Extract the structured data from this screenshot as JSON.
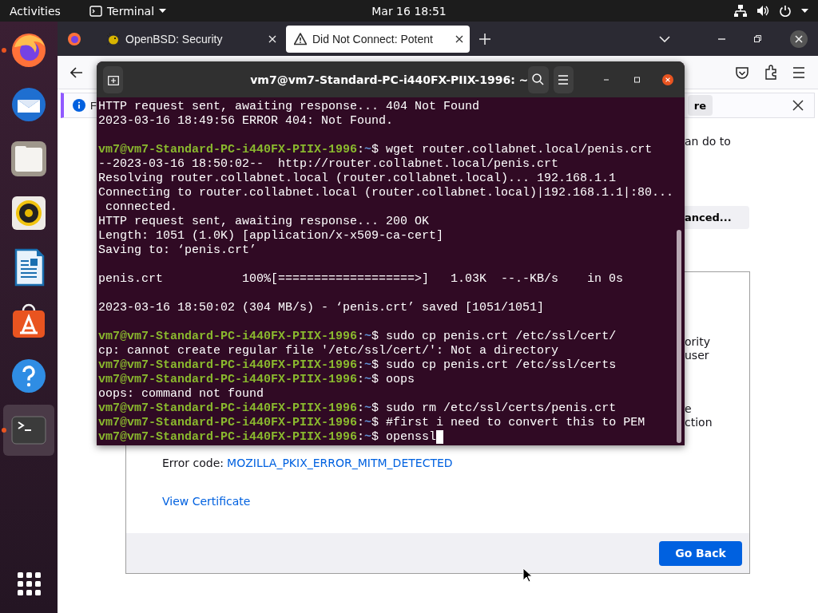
{
  "top_bar": {
    "activities": "Activities",
    "app_menu": "Terminal",
    "clock": "Mar 16  18:51"
  },
  "dock": {
    "items": [
      {
        "kind": "firefox",
        "running": true,
        "selected": false
      },
      {
        "kind": "thunderbird",
        "running": false,
        "selected": false
      },
      {
        "kind": "files",
        "running": false,
        "selected": false
      },
      {
        "kind": "rhythmbox",
        "running": false,
        "selected": false
      },
      {
        "kind": "writer",
        "running": false,
        "selected": false
      },
      {
        "kind": "software",
        "running": false,
        "selected": false
      },
      {
        "kind": "help",
        "running": false,
        "selected": false
      },
      {
        "kind": "terminal",
        "running": true,
        "selected": true
      }
    ],
    "show_apps": {
      "kind": "grid"
    }
  },
  "browser": {
    "tabs": [
      {
        "title": "OpenBSD: Security",
        "selected": false
      },
      {
        "title": "Did Not Connect: Potent",
        "selected": true
      }
    ],
    "notification": {
      "text": "F",
      "button": "re"
    },
    "page": {
      "fragments": [
        "an do to"
      ],
      "advanced_button": "anced...",
      "panel": {
        "paragraphs": [
          [
            "ority",
            "user"
          ],
          [
            "e",
            "ction"
          ]
        ],
        "error_code_label": "Error code:",
        "error_code": "MOZILLA_PKIX_ERROR_MITM_DETECTED",
        "view_certificate": "View Certificate",
        "go_back": "Go Back"
      }
    }
  },
  "terminal": {
    "title": "vm7@vm7-Standard-PC-i440FX-PIIX-1996: ~",
    "lines": [
      {
        "kind": "output",
        "text": "HTTP request sent, awaiting response... 404 Not Found"
      },
      {
        "kind": "output",
        "text": "2023-03-16 18:49:56 ERROR 404: Not Found."
      },
      {
        "kind": "blank"
      },
      {
        "kind": "prompt",
        "user_host": "vm7@vm7-Standard-PC-i440FX-PIIX-1996",
        "sep": ":",
        "path": "~",
        "sign": "$",
        "command": "wget router.collabnet.local/penis.crt"
      },
      {
        "kind": "output",
        "text": "--2023-03-16 18:50:02--  http://router.collabnet.local/penis.crt"
      },
      {
        "kind": "output",
        "text": "Resolving router.collabnet.local (router.collabnet.local)... 192.168.1.1"
      },
      {
        "kind": "output",
        "text": "Connecting to router.collabnet.local (router.collabnet.local)|192.168.1.1|:80..."
      },
      {
        "kind": "output",
        "text": " connected."
      },
      {
        "kind": "output",
        "text": "HTTP request sent, awaiting response... 200 OK"
      },
      {
        "kind": "output",
        "text": "Length: 1051 (1.0K) [application/x-x509-ca-cert]"
      },
      {
        "kind": "output",
        "text": "Saving to: ‘penis.crt’"
      },
      {
        "kind": "blank"
      },
      {
        "kind": "output",
        "text": "penis.crt           100%[===================>]   1.03K  --.-KB/s    in 0s"
      },
      {
        "kind": "blank"
      },
      {
        "kind": "output",
        "text": "2023-03-16 18:50:02 (304 MB/s) - ‘penis.crt’ saved [1051/1051]"
      },
      {
        "kind": "blank"
      },
      {
        "kind": "prompt",
        "user_host": "vm7@vm7-Standard-PC-i440FX-PIIX-1996",
        "sep": ":",
        "path": "~",
        "sign": "$",
        "command": "sudo cp penis.crt /etc/ssl/cert/"
      },
      {
        "kind": "output",
        "text": "cp: cannot create regular file '/etc/ssl/cert/': Not a directory"
      },
      {
        "kind": "prompt",
        "user_host": "vm7@vm7-Standard-PC-i440FX-PIIX-1996",
        "sep": ":",
        "path": "~",
        "sign": "$",
        "command": "sudo cp penis.crt /etc/ssl/certs"
      },
      {
        "kind": "prompt",
        "user_host": "vm7@vm7-Standard-PC-i440FX-PIIX-1996",
        "sep": ":",
        "path": "~",
        "sign": "$",
        "command": "oops"
      },
      {
        "kind": "output",
        "text": "oops: command not found"
      },
      {
        "kind": "prompt",
        "user_host": "vm7@vm7-Standard-PC-i440FX-PIIX-1996",
        "sep": ":",
        "path": "~",
        "sign": "$",
        "command": "sudo rm /etc/ssl/certs/penis.crt"
      },
      {
        "kind": "prompt",
        "user_host": "vm7@vm7-Standard-PC-i440FX-PIIX-1996",
        "sep": ":",
        "path": "~",
        "sign": "$",
        "command": "#first i need to convert this to PEM"
      },
      {
        "kind": "prompt",
        "user_host": "vm7@vm7-Standard-PC-i440FX-PIIX-1996",
        "sep": ":",
        "path": "~",
        "sign": "$",
        "command": "openssl",
        "cursor": true
      }
    ]
  }
}
